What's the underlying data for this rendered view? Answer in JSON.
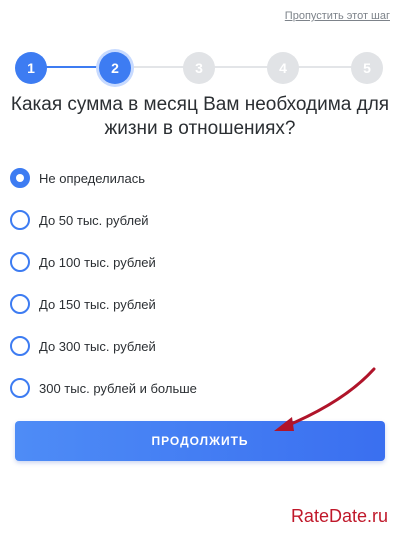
{
  "skip_link": "Пропустить этот шаг",
  "stepper": {
    "steps": [
      "1",
      "2",
      "3",
      "4",
      "5"
    ],
    "current_step": 2
  },
  "question": "Какая сумма в месяц Вам необходима для жизни в отношениях?",
  "options": [
    {
      "label": "Не определилась",
      "selected": true
    },
    {
      "label": "До 50 тыс. рублей",
      "selected": false
    },
    {
      "label": "До 100 тыс. рублей",
      "selected": false
    },
    {
      "label": "До 150 тыс. рублей",
      "selected": false
    },
    {
      "label": "До 300 тыс. рублей",
      "selected": false
    },
    {
      "label": "300 тыс. рублей и больше",
      "selected": false
    }
  ],
  "continue_button": "ПРОДОЛЖИТЬ",
  "watermark": "RateDate.ru",
  "colors": {
    "accent": "#3d7cf2",
    "inactive_step": "#e1e3e6",
    "annotation_arrow": "#b0142a"
  },
  "icons": {
    "annotation": "red-arrow-icon"
  }
}
